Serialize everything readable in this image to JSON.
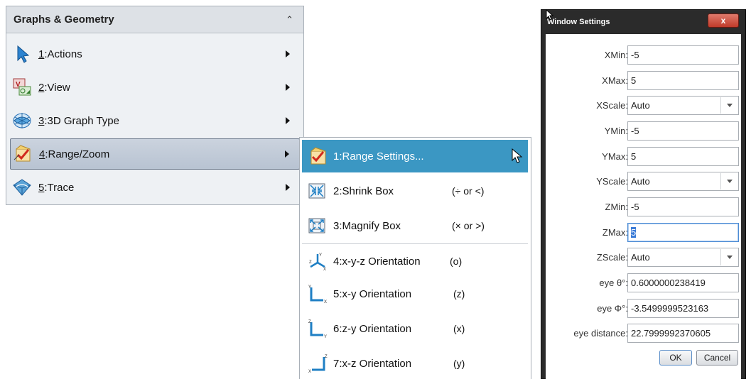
{
  "menu": {
    "title": "Graphs & Geometry",
    "items": [
      {
        "num": "1",
        "text": ":Actions",
        "icon": "pointer-arrow-icon"
      },
      {
        "num": "2",
        "text": ":View",
        "icon": "view-icon"
      },
      {
        "num": "3",
        "text": ":3D Graph Type",
        "icon": "3d-graph-type-icon"
      },
      {
        "num": "4",
        "text": ":Range/Zoom",
        "icon": "range-zoom-icon"
      },
      {
        "num": "5",
        "text": ":Trace",
        "icon": "trace-icon"
      }
    ]
  },
  "submenu": {
    "items": [
      {
        "label": "1:Range Settings...",
        "shortcut": ""
      },
      {
        "label": "2:Shrink Box",
        "shortcut": "(÷ or <)"
      },
      {
        "label": "3:Magnify Box",
        "shortcut": "(× or >)"
      },
      {
        "label": "4:x-y-z Orientation",
        "shortcut": "(o)"
      },
      {
        "label": "5:x-y Orientation",
        "shortcut": "(z)"
      },
      {
        "label": "6:z-y Orientation",
        "shortcut": "(x)"
      },
      {
        "label": "7:x-z Orientation",
        "shortcut": "(y)"
      }
    ]
  },
  "dialog": {
    "title": "Window Settings",
    "close": "x",
    "fields": [
      {
        "label": "XMin:",
        "value": "-5"
      },
      {
        "label": "XMax:",
        "value": "5"
      },
      {
        "label": "XScale:",
        "value": "Auto"
      },
      {
        "label": "YMin:",
        "value": "-5"
      },
      {
        "label": "YMax:",
        "value": "5"
      },
      {
        "label": "YScale:",
        "value": "Auto"
      },
      {
        "label": "ZMin:",
        "value": "-5"
      },
      {
        "label": "ZMax:",
        "value": "5"
      },
      {
        "label": "ZScale:",
        "value": "Auto"
      },
      {
        "label": "eye θ°:",
        "value": "0.6000000238419"
      },
      {
        "label": "eye Φ°:",
        "value": "-3.5499999523163"
      },
      {
        "label": "eye distance:",
        "value": "22.7999992370605"
      }
    ],
    "ok": "OK",
    "cancel": "Cancel"
  },
  "colors": {
    "highlight": "#3b97c3",
    "selected_item": "#c3cbd8",
    "close_button": "#c94a3a"
  }
}
